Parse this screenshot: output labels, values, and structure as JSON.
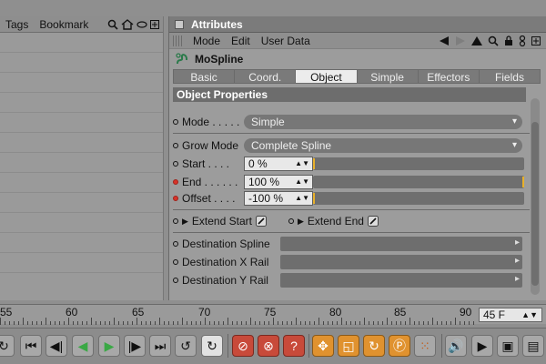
{
  "left_panel": {
    "menu": [
      "Tags",
      "Bookmark"
    ]
  },
  "attributes": {
    "title": "Attributes",
    "menu": [
      "Mode",
      "Edit",
      "User Data"
    ],
    "object_name": "MoSpline",
    "tabs": [
      "Basic",
      "Coord.",
      "Object",
      "Simple",
      "Effectors",
      "Fields"
    ],
    "active_tab": "Object",
    "section_title": "Object Properties",
    "mode": {
      "label": "Mode . . . . .",
      "value": "Simple"
    },
    "grow_mode": {
      "label": "Grow Mode",
      "value": "Complete Spline"
    },
    "start": {
      "label": "Start  . . . .",
      "value": "0 %",
      "level": 0.0
    },
    "end": {
      "label": "End . . . . . .",
      "value": "100 %",
      "level": 1.0
    },
    "offset": {
      "label": "Offset . . . .",
      "value": "-100 %",
      "level": 0.0
    },
    "extend_start": {
      "label": "Extend Start",
      "checked": true
    },
    "extend_end": {
      "label": "Extend End",
      "checked": true
    },
    "destination_spline": {
      "label": "Destination Spline"
    },
    "destination_x_rail": {
      "label": "Destination X Rail"
    },
    "destination_y_rail": {
      "label": "Destination Y Rail"
    }
  },
  "timeline": {
    "ticks": [
      "55",
      "60",
      "65",
      "70",
      "75",
      "80",
      "85",
      "90"
    ],
    "current_frame": "45 F"
  },
  "colors": {
    "active_tab_bg": "#ececec",
    "keyframe_dot": "#d6332a",
    "play_green": "#3aa845",
    "record_red": "#c84a3a",
    "tool_orange": "#e0922f"
  }
}
